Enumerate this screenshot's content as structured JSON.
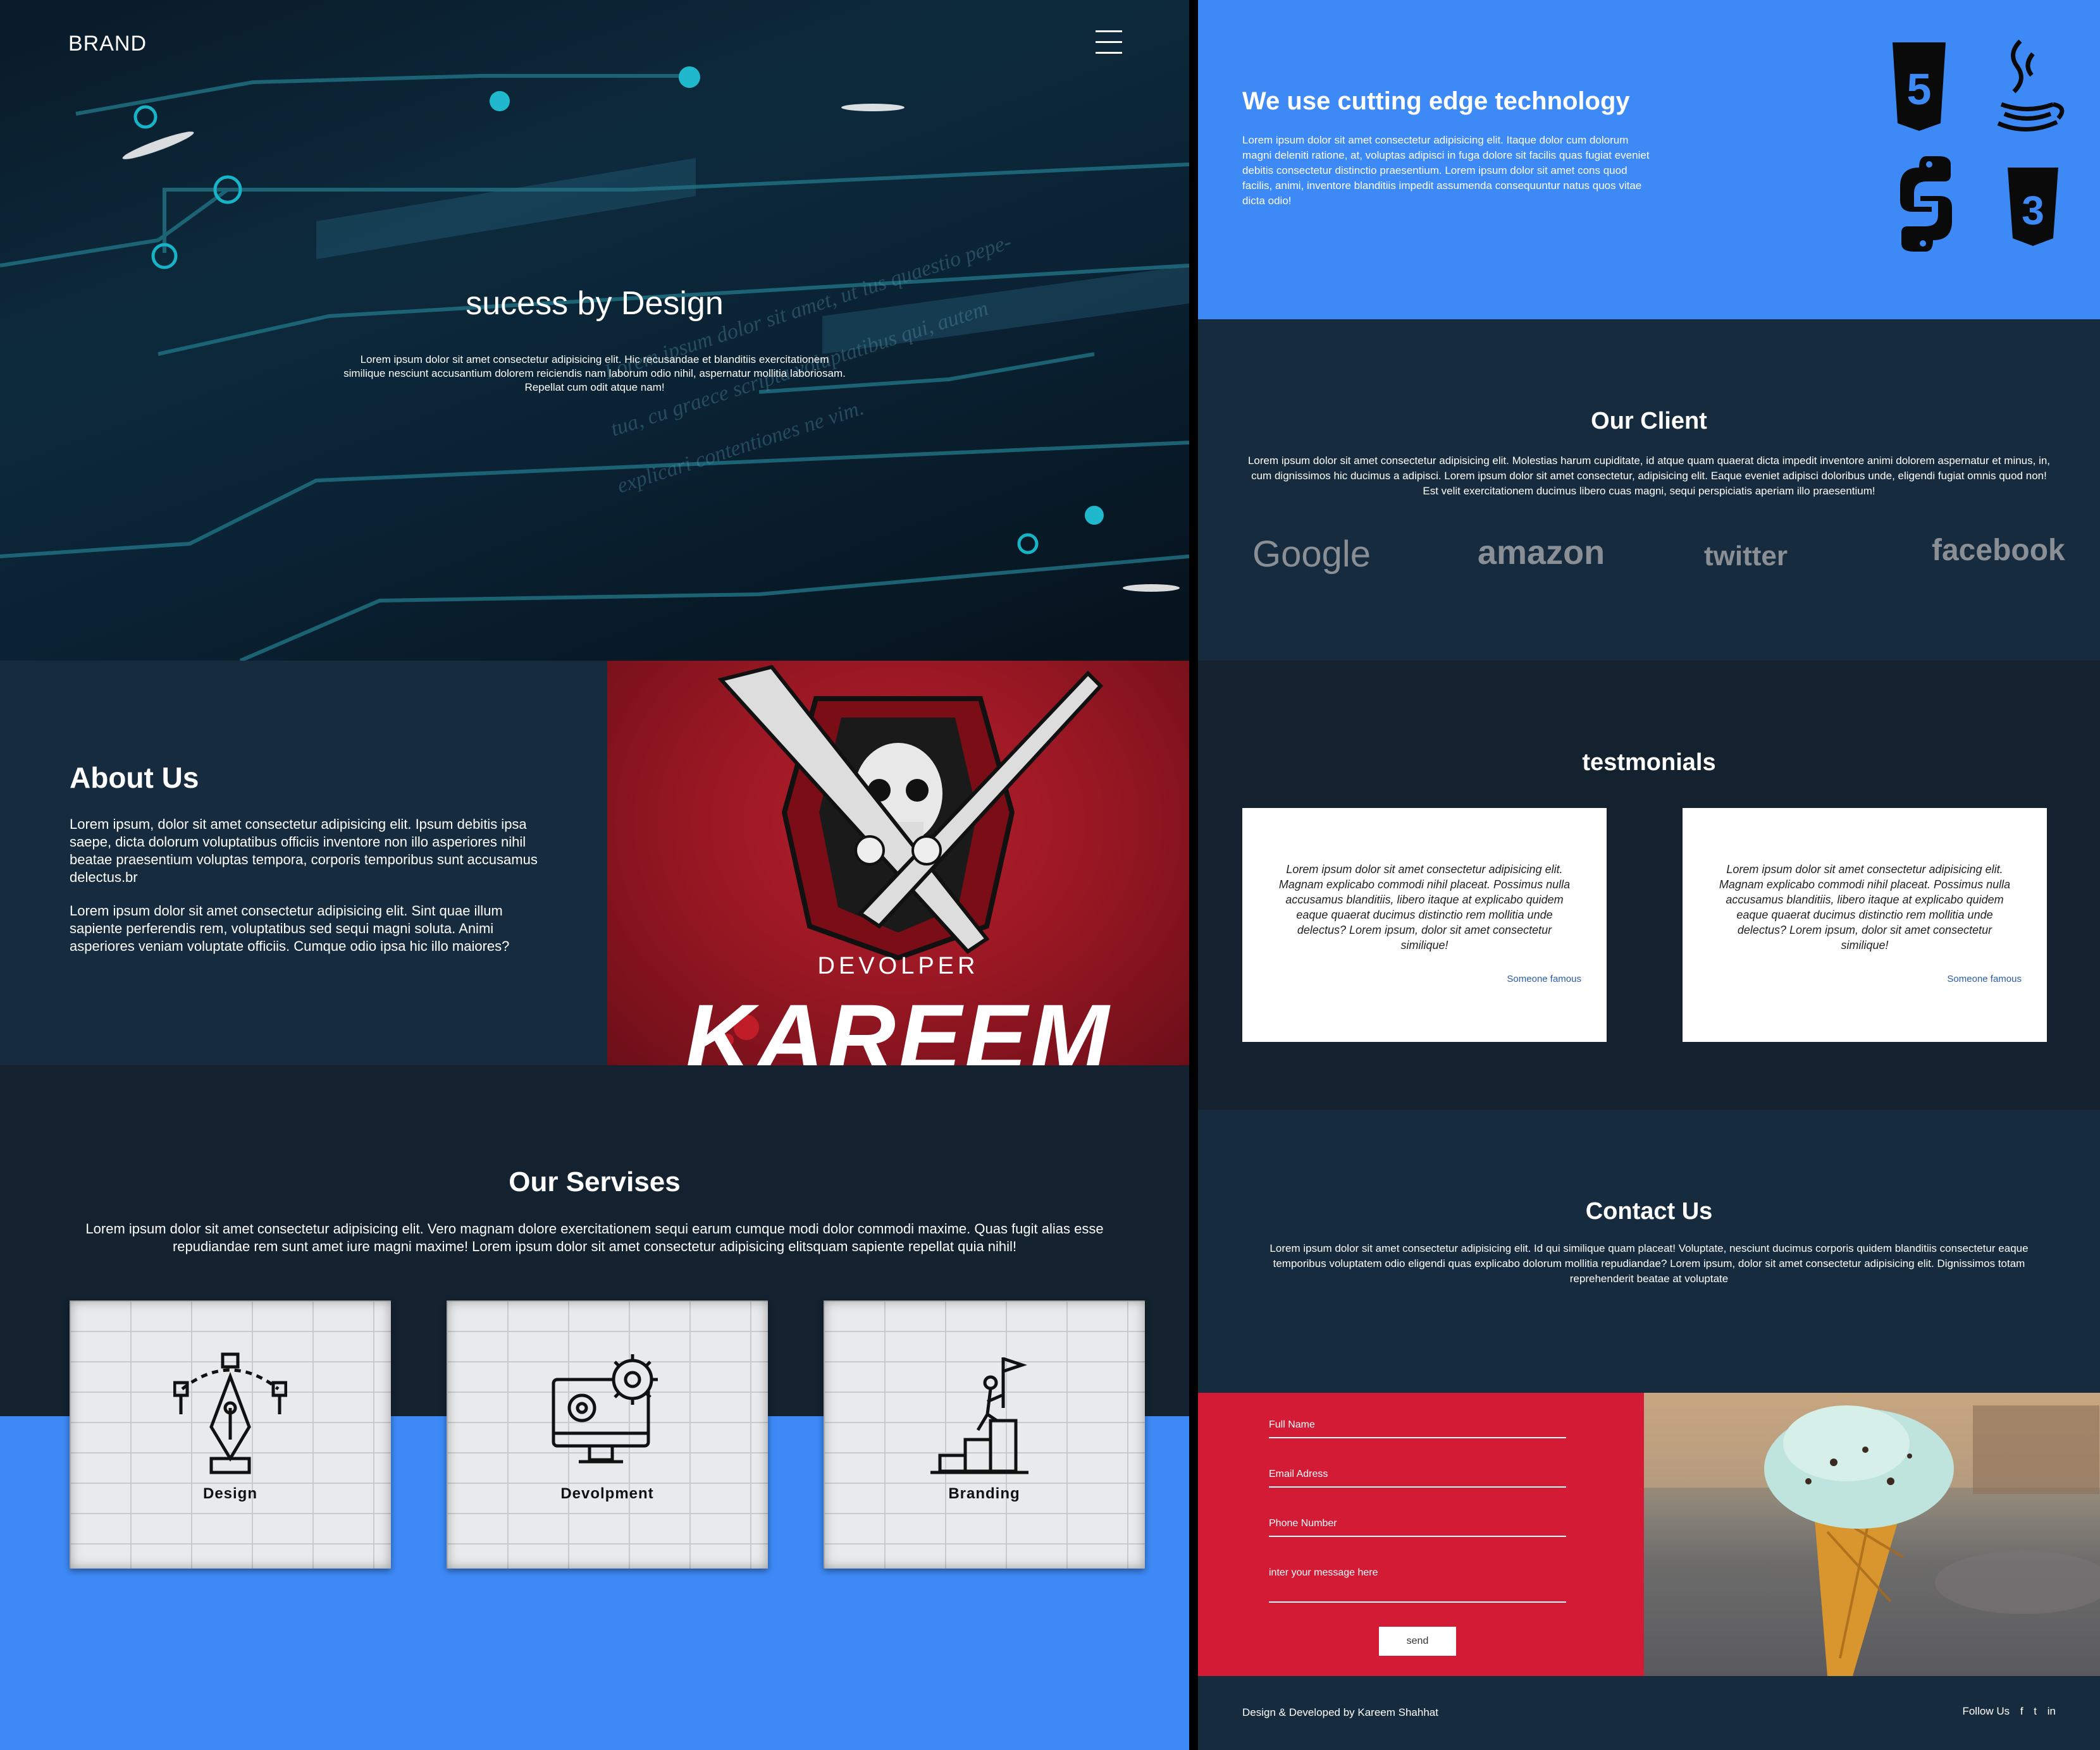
{
  "navbar": {
    "brand": "BRAND",
    "menu_icon": "hamburger-menu-icon"
  },
  "hero": {
    "title": "sucess by Design",
    "text": "Lorem ipsum dolor sit amet consectetur adipisicing elit. Hic recusandae et blanditiis exercitationem similique nesciunt accusantium dolorem reiciendis nam laborum odio nihil, aspernatur mollitia laboriosam. Repellat cum odit atque nam!",
    "background_text": [
      "Lorem ipsum dolor sit amet, ut ius quaestio pepe-",
      "tua, cu graece scripta voluptatibus qui, autem",
      "explicari contentiones ne vim."
    ]
  },
  "about": {
    "title": "About Us",
    "p1": "Lorem ipsum, dolor sit amet consectetur adipisicing elit. Ipsum debitis ipsa saepe, dicta dolorum voluptatibus officiis inventore non illo asperiores nihil beatae praesentium voluptas tempora, corporis temporibus sunt accusamus delectus.br",
    "p2": "Lorem ipsum dolor sit amet consectetur adipisicing elit. Sint quae illum sapiente perferendis rem, voluptatibus sed sequi magni soluta. Animi asperiores veniam voluptate officiis. Cumque odio ipsa hic illo maiores?",
    "logo_sub": "DEVOLPER",
    "logo_name": "KAREEM"
  },
  "services": {
    "title": "Our Servises",
    "text": "Lorem ipsum dolor sit amet consectetur adipisicing elit. Vero magnam dolore exercitationem sequi earum cumque modi dolor commodi maxime. Quas fugit alias esse repudiandae rem sunt amet iure magni maxime! Lorem ipsum dolor sit amet consectetur adipisicing elitsquam sapiente repellat quia nihil!",
    "cards": [
      {
        "label": "Design",
        "icon": "pen-tool-icon"
      },
      {
        "label": "Devolpment",
        "icon": "monitor-gears-icon"
      },
      {
        "label": "Branding",
        "icon": "climber-flag-icon"
      }
    ]
  },
  "tech": {
    "title": "We use cutting edge technology",
    "text": "Lorem ipsum dolor sit amet consectetur adipisicing elit. Itaque dolor cum dolorum magni deleniti ratione, at, voluptas adipisci in fuga dolore sit facilis quas fugiat eveniet debitis consectetur distinctio praesentium. Lorem ipsum dolor sit amet cons quod facilis, animi, inventore blanditiis impedit assumenda consequuntur natus quos vitae dicta odio!",
    "icons": [
      "html5-icon",
      "java-icon",
      "python-icon",
      "css3-icon"
    ],
    "icon_text": {
      "html": "5",
      "css": "3"
    }
  },
  "clients": {
    "title": "Our Client",
    "text": "Lorem ipsum dolor sit amet consectetur adipisicing elit. Molestias harum cupiditate, id atque quam quaerat dicta impedit inventore animi dolorem aspernatur et minus, in, cum dignissimos hic ducimus a adipisci. Lorem ipsum dolor sit amet consectetur, adipisicing elit. Eaque eveniet adipisci doloribus unde, eligendi fugiat omnis quod non! Est velit exercitationem ducimus libero cuas magni, sequi perspiciatis aperiam illo praesentium!",
    "logos": [
      "Google",
      "amazon",
      "twitter",
      "facebook"
    ]
  },
  "testimonials": {
    "title": "testmonials",
    "items": [
      {
        "quote": "Lorem ipsum dolor sit amet consectetur adipisicing elit. Magnam explicabo commodi nihil placeat. Possimus nulla accusamus blanditiis, libero itaque at explicabo quidem eaque quaerat ducimus distinctio rem mollitia unde delectus? Lorem ipsum, dolor sit amet consectetur similique!",
        "author": "Someone famous"
      },
      {
        "quote": "Lorem ipsum dolor sit amet consectetur adipisicing elit. Magnam explicabo commodi nihil placeat. Possimus nulla accusamus blanditiis, libero itaque at explicabo quidem eaque quaerat ducimus distinctio rem mollitia unde delectus? Lorem ipsum, dolor sit amet consectetur similique!",
        "author": "Someone famous"
      }
    ]
  },
  "contact": {
    "title": "Contact Us",
    "text": "Lorem ipsum dolor sit amet consectetur adipisicing elit. Id qui similique quam placeat! Voluptate, nesciunt ducimus corporis quidem blanditiis consectetur eaque temporibus voluptatem odio eligendi quas explicabo dolorum mollitia repudiandae? Lorem ipsum, dolor sit amet consectetur adipisicing elit. Dignissimos totam reprehenderit beatae at voluptate",
    "form": {
      "full_name_placeholder": "Full Name",
      "email_placeholder": "Email Adress",
      "phone_placeholder": "Phone Number",
      "message_placeholder": "inter your message here",
      "send_label": "send"
    }
  },
  "footer": {
    "credit": "Design & Developed by Kareem Shahhat",
    "follow_label": "Follow Us",
    "social": [
      "f",
      "t",
      "in"
    ]
  },
  "colors": {
    "accent_blue": "#3d8af7",
    "navy": "#172b3e",
    "dark_navy": "#14222f",
    "red": "#d41b35",
    "logo_red": "#9b1824"
  }
}
